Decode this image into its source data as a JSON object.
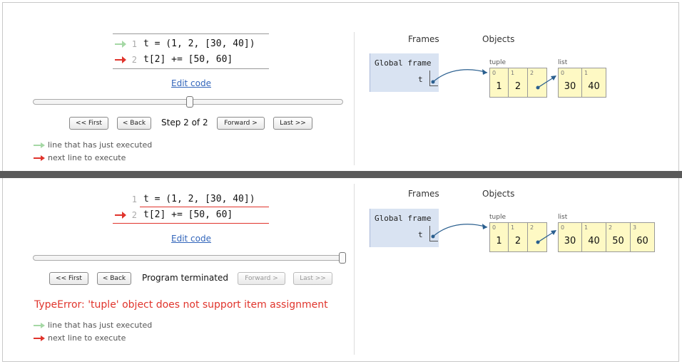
{
  "colors": {
    "error_red": "#e0342c",
    "executed_green": "#a5d8a5",
    "link_blue": "#3366bb",
    "frame_blue": "#d9e3f2",
    "object_yellow": "#fef9c4",
    "pointer": "#2a5f8f"
  },
  "top": {
    "code": [
      {
        "num": "1",
        "text": "t = (1, 2, [30, 40])",
        "arrow": "green"
      },
      {
        "num": "2",
        "text": "t[2] += [50, 60]",
        "arrow": "red"
      }
    ],
    "edit_code": "Edit code",
    "slider_position": 0.5,
    "buttons": {
      "first": "<< First",
      "back": "< Back",
      "forward": "Forward >",
      "last": "Last >>"
    },
    "status": "Step 2 of 2",
    "legend": {
      "executed": "line that has just executed",
      "next": "next line to execute"
    },
    "viz": {
      "frames_heading": "Frames",
      "objects_heading": "Objects",
      "global_frame": "Global frame",
      "var_name": "t",
      "tuple": {
        "label": "tuple",
        "indices": [
          "0",
          "1",
          "2"
        ],
        "values": [
          "1",
          "2",
          ""
        ]
      },
      "list": {
        "label": "list",
        "indices": [
          "0",
          "1"
        ],
        "values": [
          "30",
          "40"
        ]
      }
    }
  },
  "bottom": {
    "code": [
      {
        "num": "1",
        "text": "t = (1, 2, [30, 40])",
        "arrow": "none"
      },
      {
        "num": "2",
        "text": "t[2] += [50, 60]",
        "arrow": "red"
      }
    ],
    "edit_code": "Edit code",
    "slider_position": 1.0,
    "buttons": {
      "first": "<< First",
      "back": "< Back",
      "forward": "Forward >",
      "last": "Last >>"
    },
    "status": "Program terminated",
    "error": "TypeError: 'tuple' object does not support item assignment",
    "legend": {
      "executed": "line that has just executed",
      "next": "next line to execute"
    },
    "viz": {
      "frames_heading": "Frames",
      "objects_heading": "Objects",
      "global_frame": "Global frame",
      "var_name": "t",
      "tuple": {
        "label": "tuple",
        "indices": [
          "0",
          "1",
          "2"
        ],
        "values": [
          "1",
          "2",
          ""
        ]
      },
      "list": {
        "label": "list",
        "indices": [
          "0",
          "1",
          "2",
          "3"
        ],
        "values": [
          "30",
          "40",
          "50",
          "60"
        ]
      }
    }
  }
}
